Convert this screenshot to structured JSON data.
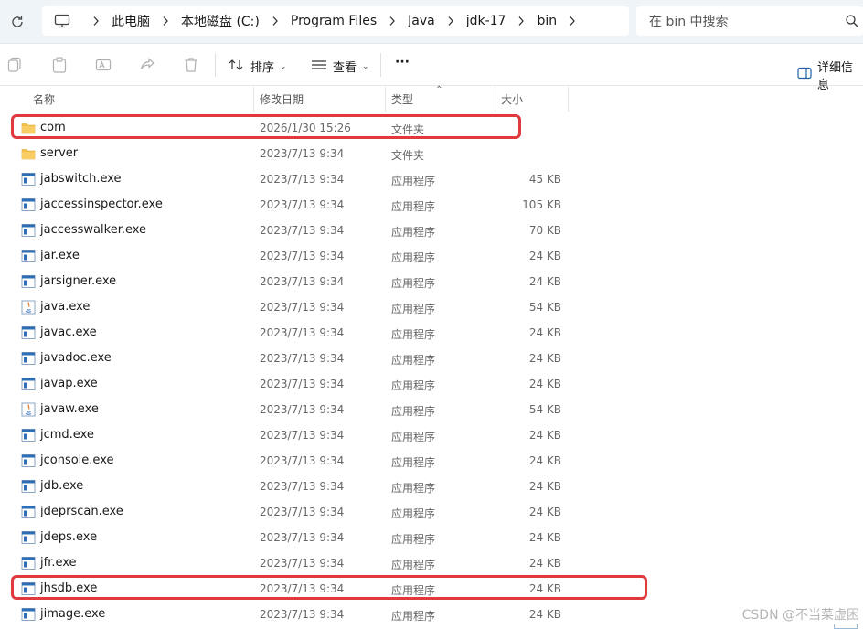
{
  "address_bar": {
    "crumbs": [
      "此电脑",
      "本地磁盘 (C:)",
      "Program Files",
      "Java",
      "jdk-17",
      "bin"
    ]
  },
  "search": {
    "placeholder": "在 bin 中搜索"
  },
  "command_bar": {
    "sort_label": "排序",
    "view_label": "查看",
    "more_label": "···",
    "details_label": "详细信息"
  },
  "columns": {
    "name": "名称",
    "date": "修改日期",
    "type": "类型",
    "size": "大小"
  },
  "files": [
    {
      "name": "com",
      "date": "2026/1/30 15:26",
      "type": "文件夹",
      "size": "",
      "icon": "folder-icon",
      "highlighted": true
    },
    {
      "name": "server",
      "date": "2023/7/13 9:34",
      "type": "文件夹",
      "size": "",
      "icon": "folder-icon",
      "highlighted": false
    },
    {
      "name": "jabswitch.exe",
      "date": "2023/7/13 9:34",
      "type": "应用程序",
      "size": "45 KB",
      "icon": "exe-icon",
      "highlighted": false
    },
    {
      "name": "jaccessinspector.exe",
      "date": "2023/7/13 9:34",
      "type": "应用程序",
      "size": "105 KB",
      "icon": "exe-icon",
      "highlighted": false
    },
    {
      "name": "jaccesswalker.exe",
      "date": "2023/7/13 9:34",
      "type": "应用程序",
      "size": "70 KB",
      "icon": "exe-icon",
      "highlighted": false
    },
    {
      "name": "jar.exe",
      "date": "2023/7/13 9:34",
      "type": "应用程序",
      "size": "24 KB",
      "icon": "exe-icon",
      "highlighted": false
    },
    {
      "name": "jarsigner.exe",
      "date": "2023/7/13 9:34",
      "type": "应用程序",
      "size": "24 KB",
      "icon": "exe-icon",
      "highlighted": false
    },
    {
      "name": "java.exe",
      "date": "2023/7/13 9:34",
      "type": "应用程序",
      "size": "54 KB",
      "icon": "java-icon",
      "highlighted": false
    },
    {
      "name": "javac.exe",
      "date": "2023/7/13 9:34",
      "type": "应用程序",
      "size": "24 KB",
      "icon": "exe-icon",
      "highlighted": false
    },
    {
      "name": "javadoc.exe",
      "date": "2023/7/13 9:34",
      "type": "应用程序",
      "size": "24 KB",
      "icon": "exe-icon",
      "highlighted": false
    },
    {
      "name": "javap.exe",
      "date": "2023/7/13 9:34",
      "type": "应用程序",
      "size": "24 KB",
      "icon": "exe-icon",
      "highlighted": false
    },
    {
      "name": "javaw.exe",
      "date": "2023/7/13 9:34",
      "type": "应用程序",
      "size": "54 KB",
      "icon": "java-icon",
      "highlighted": false
    },
    {
      "name": "jcmd.exe",
      "date": "2023/7/13 9:34",
      "type": "应用程序",
      "size": "24 KB",
      "icon": "exe-icon",
      "highlighted": false
    },
    {
      "name": "jconsole.exe",
      "date": "2023/7/13 9:34",
      "type": "应用程序",
      "size": "24 KB",
      "icon": "exe-icon",
      "highlighted": false
    },
    {
      "name": "jdb.exe",
      "date": "2023/7/13 9:34",
      "type": "应用程序",
      "size": "24 KB",
      "icon": "exe-icon",
      "highlighted": false
    },
    {
      "name": "jdeprscan.exe",
      "date": "2023/7/13 9:34",
      "type": "应用程序",
      "size": "24 KB",
      "icon": "exe-icon",
      "highlighted": false
    },
    {
      "name": "jdeps.exe",
      "date": "2023/7/13 9:34",
      "type": "应用程序",
      "size": "24 KB",
      "icon": "exe-icon",
      "highlighted": false
    },
    {
      "name": "jfr.exe",
      "date": "2023/7/13 9:34",
      "type": "应用程序",
      "size": "24 KB",
      "icon": "exe-icon",
      "highlighted": false
    },
    {
      "name": "jhsdb.exe",
      "date": "2023/7/13 9:34",
      "type": "应用程序",
      "size": "24 KB",
      "icon": "exe-icon",
      "highlighted": true
    },
    {
      "name": "jimage.exe",
      "date": "2023/7/13 9:34",
      "type": "应用程序",
      "size": "24 KB",
      "icon": "exe-icon",
      "highlighted": false
    }
  ],
  "watermark": "CSDN @不当菜虚困",
  "colors": {
    "highlight": "#e0393e",
    "folder": "#f5c14b",
    "exe": "#2f6db5"
  }
}
